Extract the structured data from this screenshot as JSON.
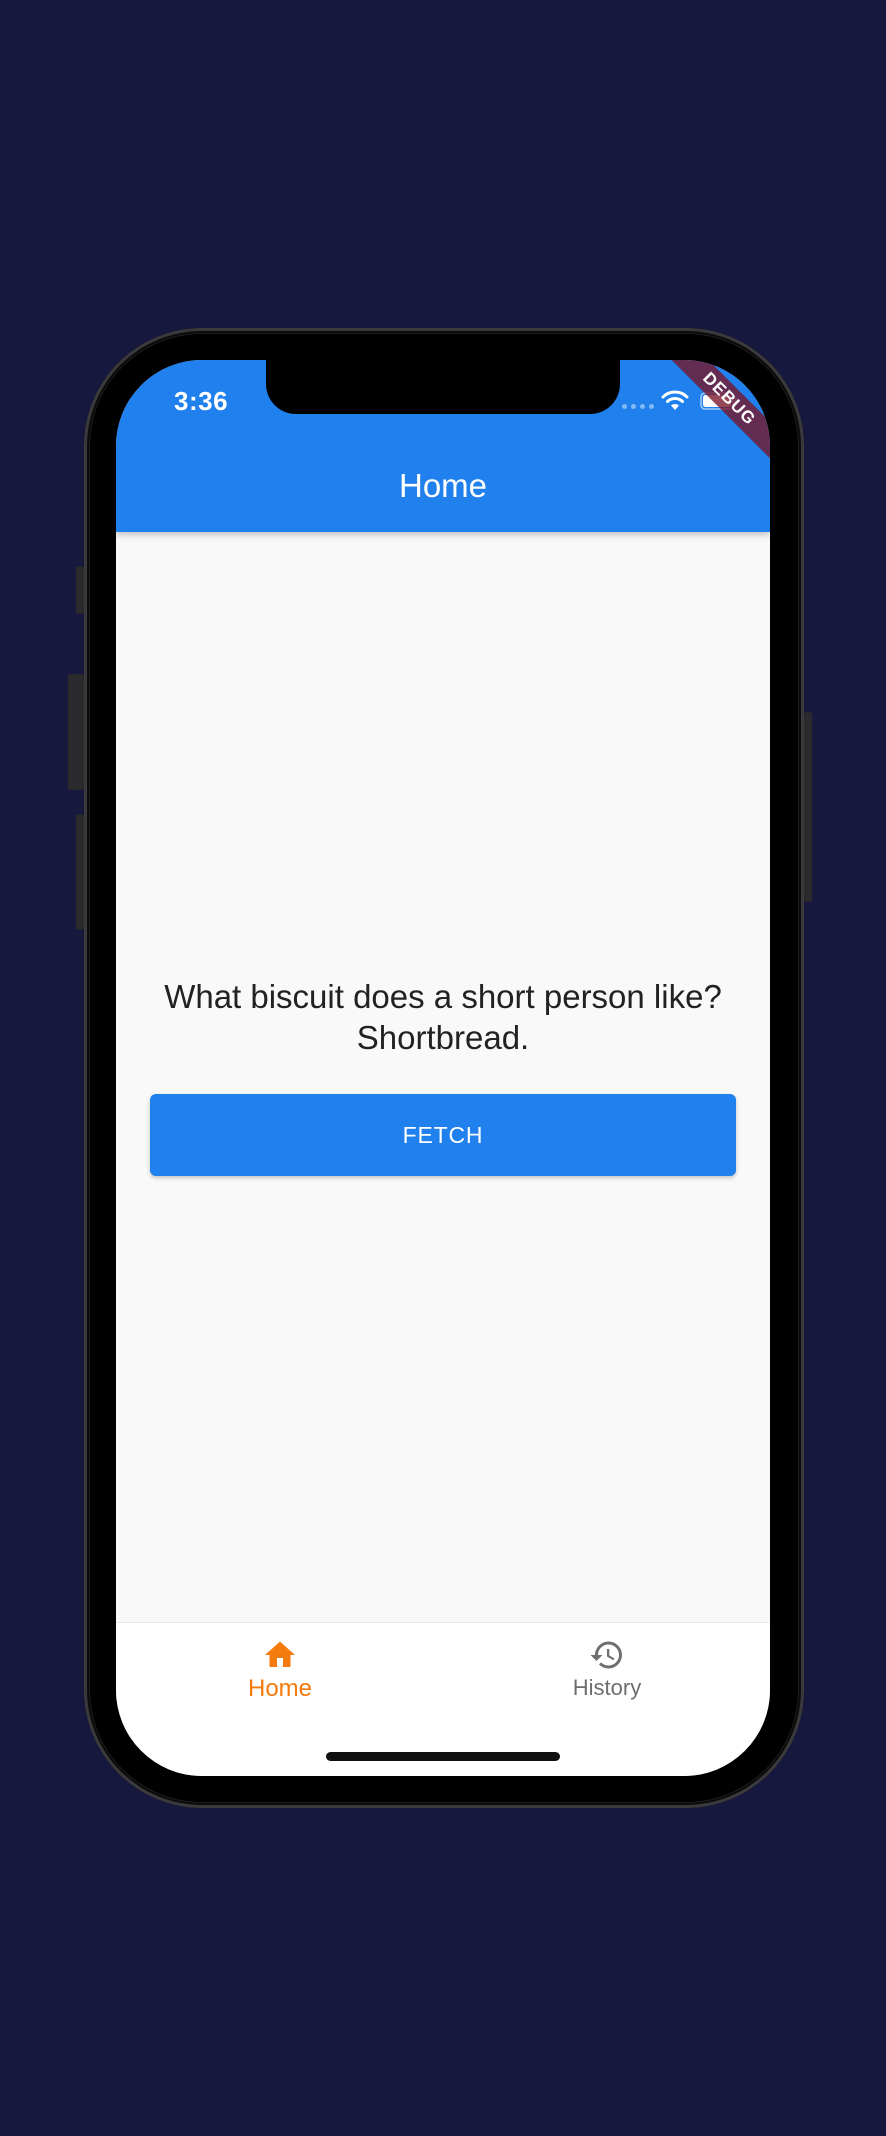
{
  "status_bar": {
    "time": "3:36"
  },
  "debug_banner": {
    "label": "DEBUG"
  },
  "app_bar": {
    "title": "Home"
  },
  "main": {
    "joke": "What biscuit does a short person like? Shortbread.",
    "fetch_label": "FETCH"
  },
  "bottom_nav": {
    "items": [
      {
        "label": "Home",
        "icon": "home-icon",
        "selected": true
      },
      {
        "label": "History",
        "icon": "history-icon",
        "selected": false
      }
    ]
  },
  "colors": {
    "background": "#16183d",
    "primary": "#1f80ee",
    "accent_selected": "#f37a0c",
    "nav_unselected": "#6e6e6e",
    "surface": "#f9f9f9"
  }
}
